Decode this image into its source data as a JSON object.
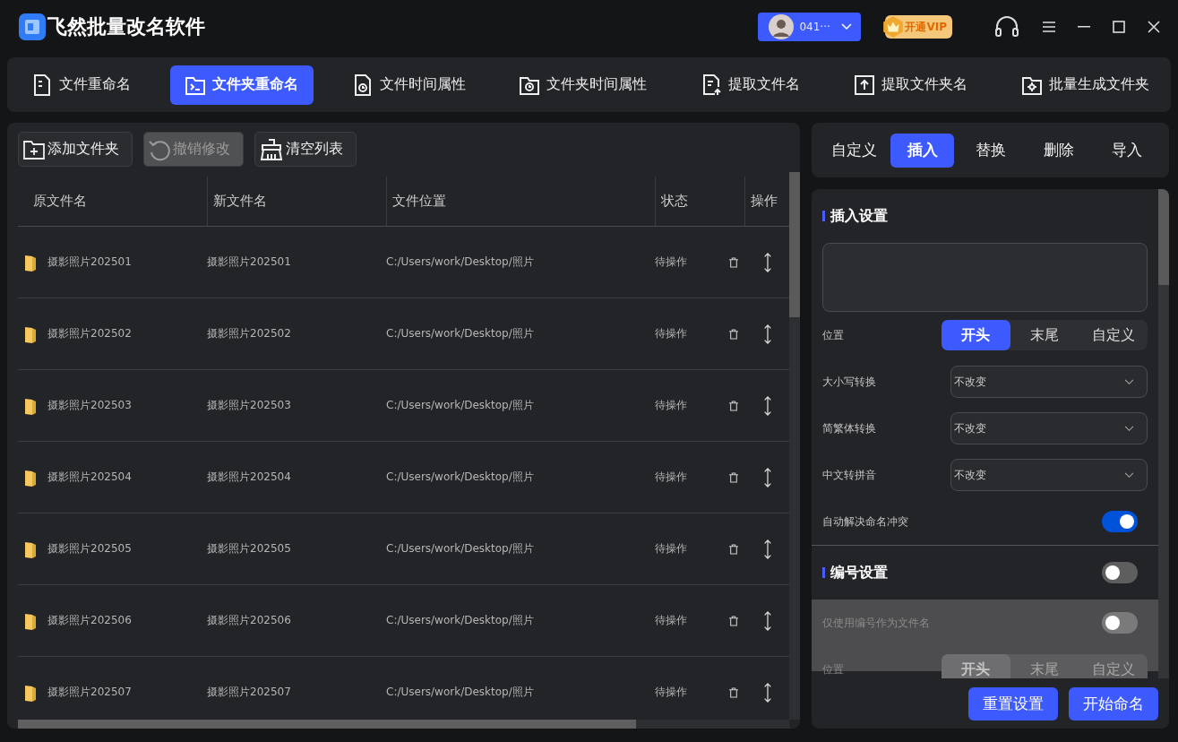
{
  "app": {
    "title": "飞然批量改名软件"
  },
  "user": {
    "name": "041···"
  },
  "vip": {
    "label": "开通VIP"
  },
  "tool_tabs": [
    {
      "label": "文件重命名",
      "selected": false
    },
    {
      "label": "文件夹重命名",
      "selected": true
    },
    {
      "label": "文件时间属性",
      "selected": false
    },
    {
      "label": "文件夹时间属性",
      "selected": false
    },
    {
      "label": "提取文件名",
      "selected": false
    },
    {
      "label": "提取文件夹名",
      "selected": false
    },
    {
      "label": "批量生成文件夹",
      "selected": false
    }
  ],
  "toolbar": [
    {
      "label": "添加文件夹",
      "disabled": false
    },
    {
      "label": "撤销修改",
      "disabled": true
    },
    {
      "label": "清空列表",
      "disabled": false
    }
  ],
  "table": {
    "columns": [
      "原文件名",
      "新文件名",
      "文件位置",
      "状态",
      "操作"
    ],
    "rows": [
      {
        "original": "摄影照片202501",
        "new": "摄影照片202501",
        "location": "C:/Users/work/Desktop/照片",
        "status": "待操作"
      },
      {
        "original": "摄影照片202502",
        "new": "摄影照片202502",
        "location": "C:/Users/work/Desktop/照片",
        "status": "待操作"
      },
      {
        "original": "摄影照片202503",
        "new": "摄影照片202503",
        "location": "C:/Users/work/Desktop/照片",
        "status": "待操作"
      },
      {
        "original": "摄影照片202504",
        "new": "摄影照片202504",
        "location": "C:/Users/work/Desktop/照片",
        "status": "待操作"
      },
      {
        "original": "摄影照片202505",
        "new": "摄影照片202505",
        "location": "C:/Users/work/Desktop/照片",
        "status": "待操作"
      },
      {
        "original": "摄影照片202506",
        "new": "摄影照片202506",
        "location": "C:/Users/work/Desktop/照片",
        "status": "待操作"
      },
      {
        "original": "摄影照片202507",
        "new": "摄影照片202507",
        "location": "C:/Users/work/Desktop/照片",
        "status": "待操作"
      }
    ]
  },
  "mode_tabs": [
    {
      "label": "自定义",
      "selected": false
    },
    {
      "label": "插入",
      "selected": true
    },
    {
      "label": "替换",
      "selected": false
    },
    {
      "label": "删除",
      "selected": false
    },
    {
      "label": "导入",
      "selected": false
    }
  ],
  "insert_settings": {
    "title": "插入设置",
    "position": {
      "label": "位置",
      "options": [
        {
          "label": "开头",
          "selected": true
        },
        {
          "label": "末尾",
          "selected": false
        },
        {
          "label": "自定义",
          "selected": false
        }
      ]
    },
    "selects": [
      {
        "label": "大小写转换",
        "value": "不改变"
      },
      {
        "label": "简繁体转换",
        "value": "不改变"
      },
      {
        "label": "中文转拼音",
        "value": "不改变"
      }
    ],
    "auto_resolve": {
      "label": "自动解决命名冲突",
      "on": true
    }
  },
  "numbering": {
    "title": "编号设置",
    "on": false,
    "only_number": {
      "label": "仅使用编号作为文件名",
      "on": false
    },
    "position": {
      "label": "位置",
      "options": [
        {
          "label": "开头",
          "selected": true
        },
        {
          "label": "末尾",
          "selected": false
        },
        {
          "label": "自定义",
          "selected": false
        }
      ]
    }
  },
  "actions": [
    {
      "label": "重置设置"
    },
    {
      "label": "开始命名"
    }
  ]
}
